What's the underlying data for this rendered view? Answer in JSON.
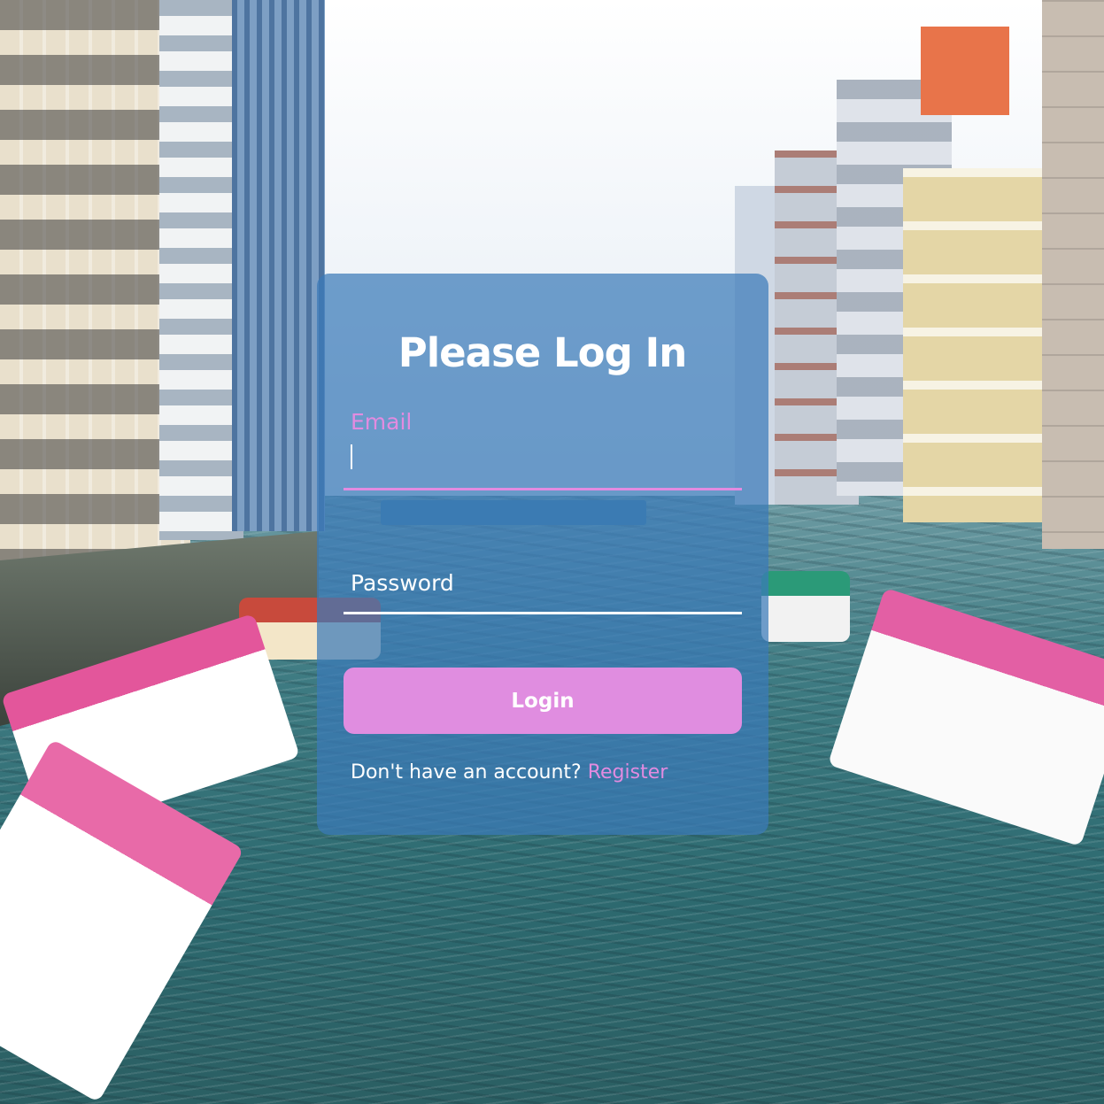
{
  "login": {
    "title": "Please Log In",
    "email_label": "Email",
    "email_value": "",
    "password_label": "Password",
    "password_value": "",
    "submit_label": "Login",
    "register_prompt": "Don't have an account?",
    "register_link": "Register"
  },
  "colors": {
    "accent": "#e08de0",
    "card": "#3a7ab9",
    "text": "#ffffff"
  }
}
